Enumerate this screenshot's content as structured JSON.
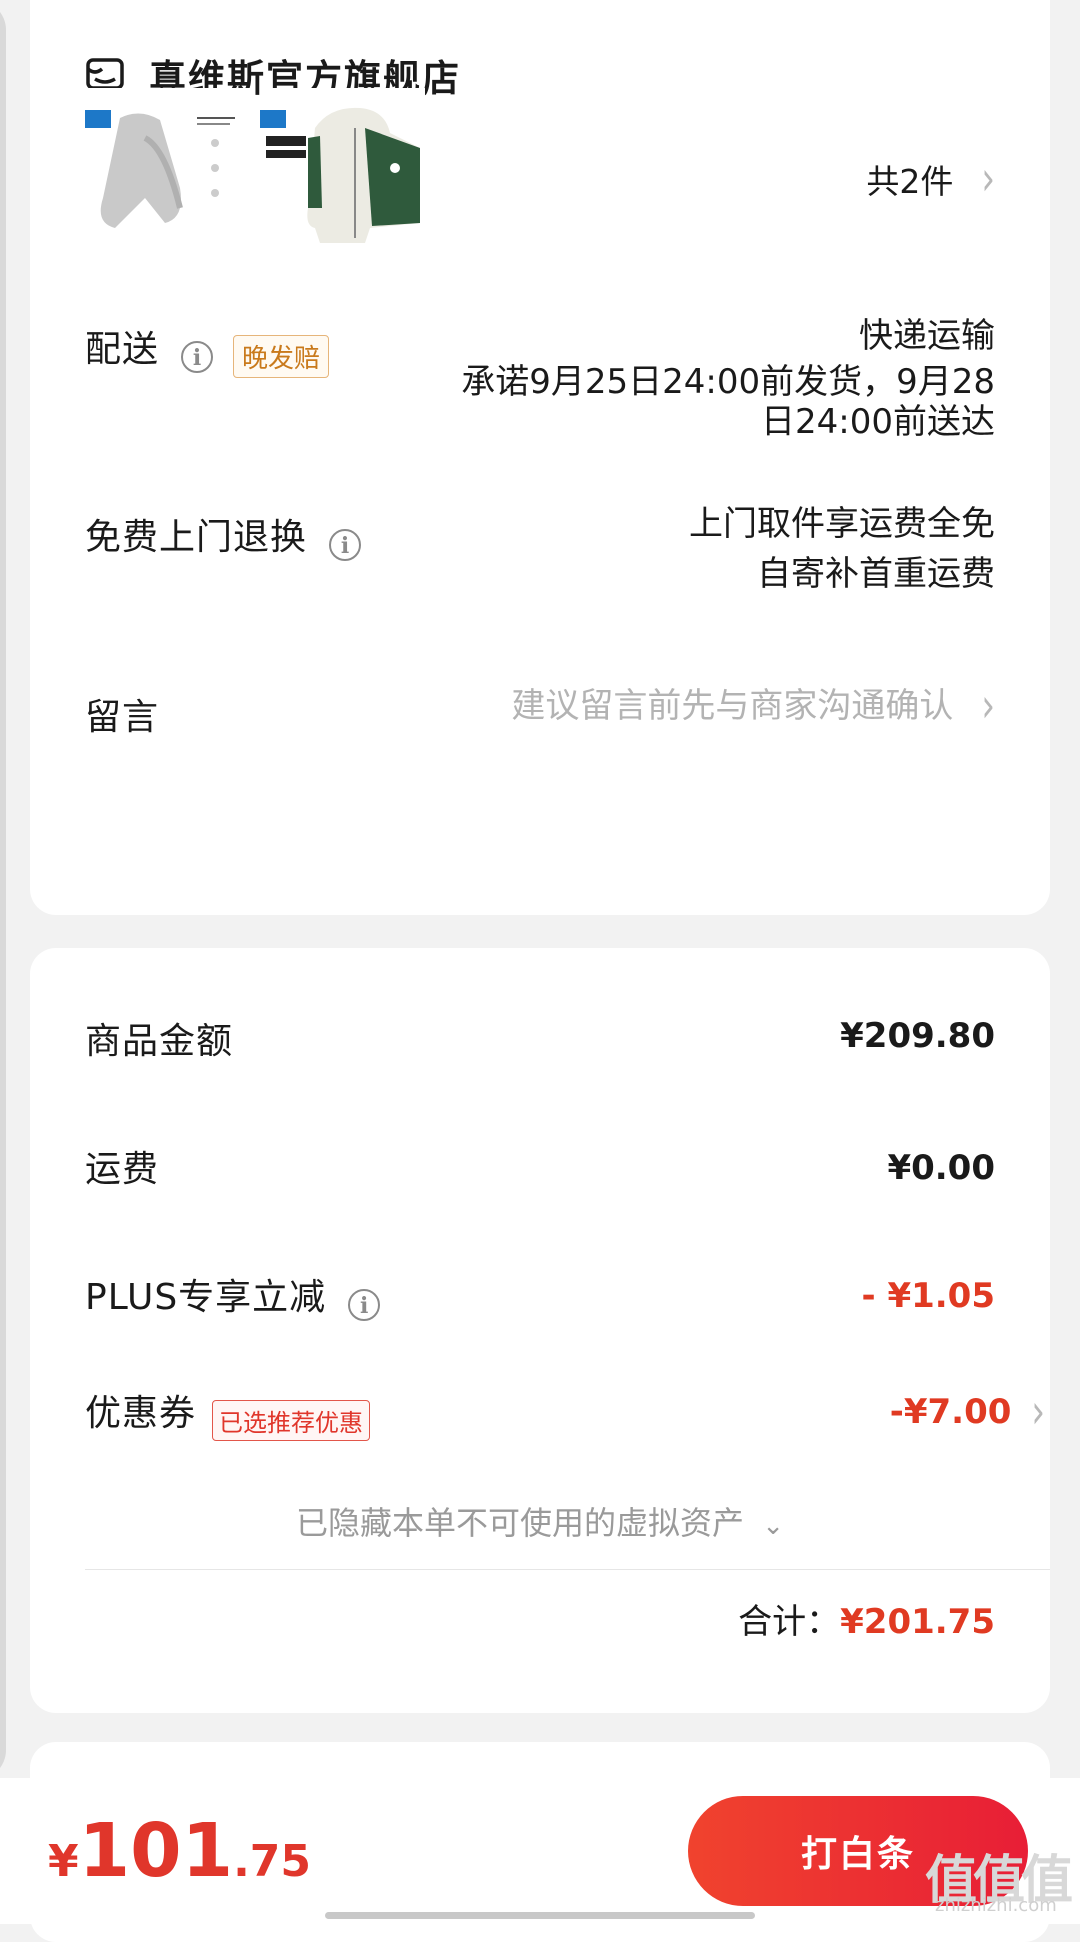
{
  "store": {
    "name": "真维斯官方旗舰店",
    "item_count": "共2件"
  },
  "delivery": {
    "label": "配送",
    "tag": "晚发赔",
    "method": "快递运输",
    "promise_line1": "承诺9月25日24:00前发货，9月28",
    "promise_line2": "日24:00前送达"
  },
  "returns": {
    "label": "免费上门退换",
    "line1": "上门取件享运费全免",
    "line2": "自寄补首重运费"
  },
  "message": {
    "label": "留言",
    "placeholder": "建议留言前先与商家沟通确认"
  },
  "price": {
    "goods_label": "商品金额",
    "goods_value": "¥209.80",
    "shipping_label": "运费",
    "shipping_value": "¥0.00",
    "plus_label": "PLUS专享立减",
    "plus_value": "- ¥1.05",
    "coupon_label": "优惠券",
    "coupon_tag": "已选推荐优惠",
    "coupon_value": "-¥7.00",
    "hidden_assets": "已隐藏本单不可使用的虚拟资产",
    "total_label": "合计：",
    "total_value": "¥201.75"
  },
  "bottom": {
    "currency": "¥",
    "amount_int": "101",
    "amount_dec": ".75",
    "pay_button": "打白条"
  },
  "watermark": {
    "logo": "值值值",
    "site": "zhizhizhi.com"
  },
  "colors": {
    "accent_red": "#e0362b",
    "late_tag": "#c97a1c"
  }
}
